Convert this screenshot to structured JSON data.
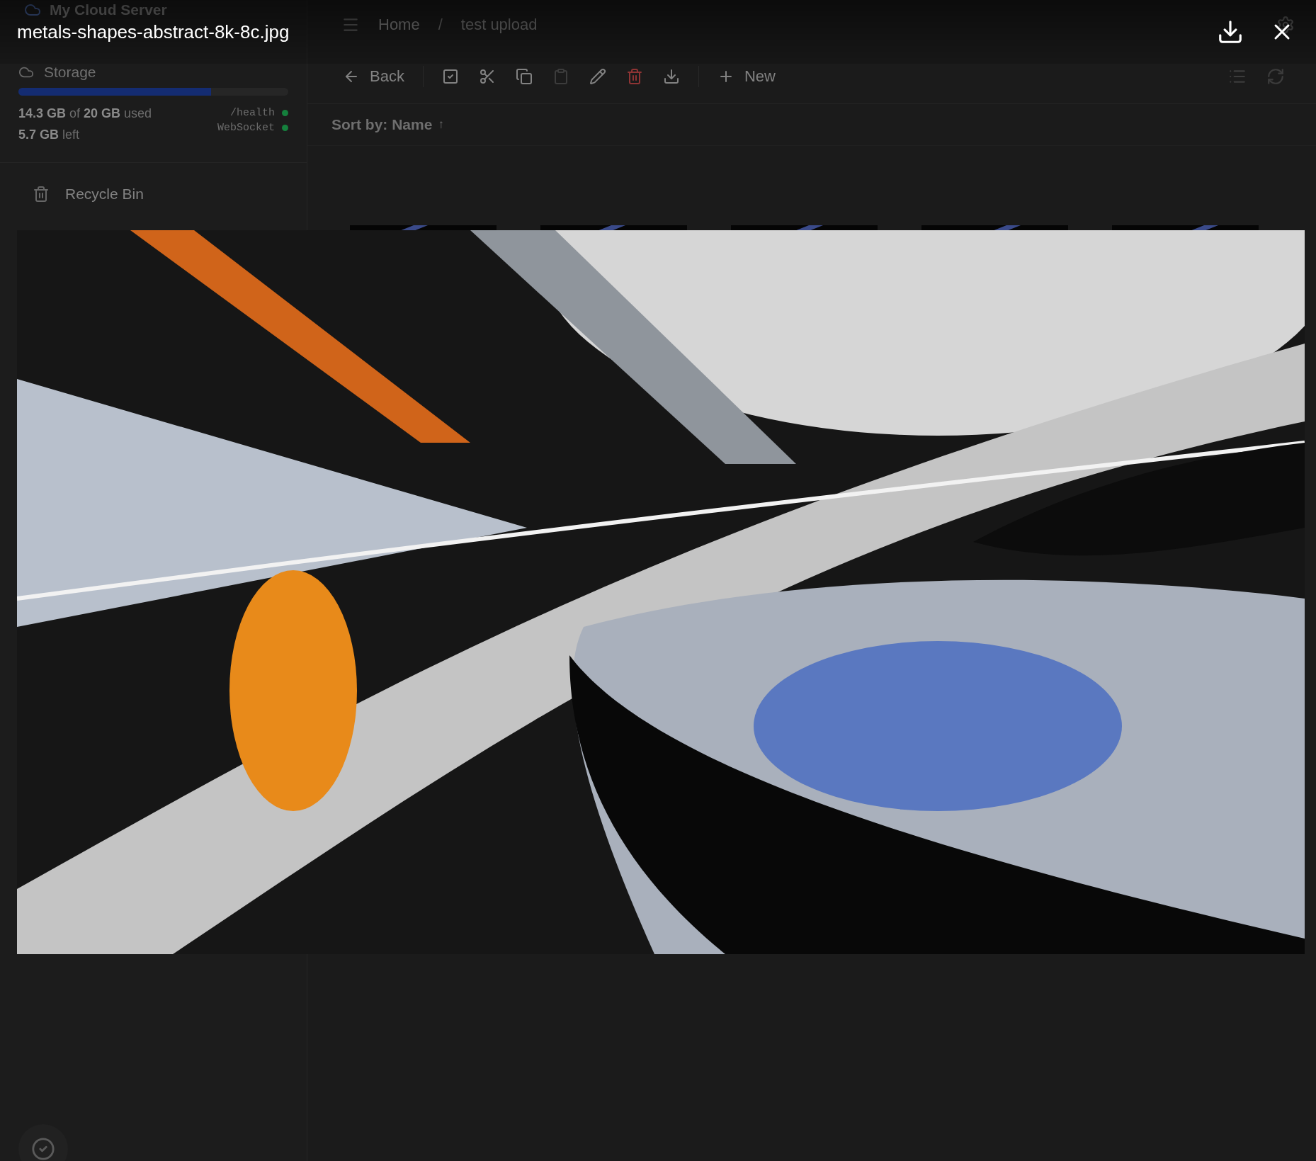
{
  "app": {
    "title": "My Cloud Server"
  },
  "sidebar": {
    "storage": {
      "label": "Storage",
      "level": 0.715,
      "used": "**14.3 GB** of **20 GB** used",
      "left": "**5.7 GB** left"
    },
    "status": [
      {
        "label": "/health",
        "color": "#15803d"
      },
      {
        "label": "WebSocket",
        "color": "#15803d"
      }
    ],
    "items": [
      {
        "label": "Recycle Bin"
      }
    ]
  },
  "breadcrumb": {
    "separator": "/",
    "items": [
      {
        "label": "Home"
      },
      {
        "label": "test upload"
      }
    ]
  },
  "toolbar": {
    "back": "Back",
    "actions": [
      {
        "disabled": false
      },
      {
        "disabled": false
      },
      {
        "disabled": false
      },
      {
        "disabled": true
      },
      {
        "disabled": false
      },
      {
        "disabled": false
      },
      {
        "disabled": false
      }
    ],
    "new": "New"
  },
  "sort": {
    "label": "Sort by: Name",
    "arrow": "↑"
  },
  "viewer": {
    "filename": "metals-shapes-abstract-8k-8c.jpg"
  }
}
